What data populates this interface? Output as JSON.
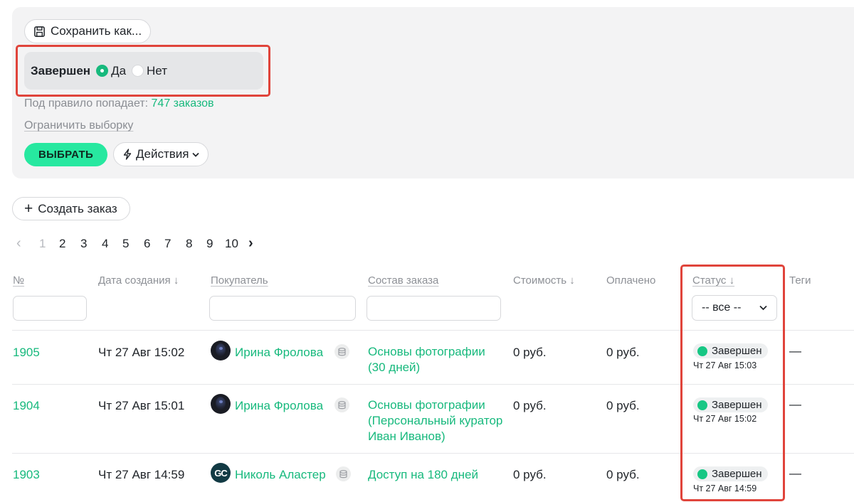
{
  "toolbar": {
    "save_label": "Сохранить как..."
  },
  "rule": {
    "label": "Завершен",
    "options": [
      {
        "label": "Да",
        "selected": true
      },
      {
        "label": "Нет",
        "selected": false
      }
    ]
  },
  "summary": {
    "prefix": "Под правило попадает: ",
    "count": "747 заказов"
  },
  "limit_link": "Ограничить выборку",
  "select_button": "ВЫБРАТЬ",
  "actions_button": "Действия",
  "create_button": "Создать заказ",
  "pagination": {
    "prev": "‹",
    "next": "›",
    "pages": [
      "1",
      "2",
      "3",
      "4",
      "5",
      "6",
      "7",
      "8",
      "9",
      "10"
    ],
    "current": "1"
  },
  "columns": [
    "№",
    "Дата создания ↓",
    "Покупатель",
    "Состав заказа",
    "Стоимость ↓",
    "Оплачено",
    "Статус ↓",
    "Теги"
  ],
  "status_filter": {
    "value": "-- все --"
  },
  "orders": [
    {
      "id": "1905",
      "date": "Чт 27 Авг 15:02",
      "buyer": "Ирина Фролова",
      "avatar": "photo",
      "items": "Основы фотографии (30 дней)",
      "cost": "0 руб.",
      "paid": "0 руб.",
      "status": "Завершен",
      "status_date": "Чт 27 Авг 15:03",
      "tags": "—"
    },
    {
      "id": "1904",
      "date": "Чт 27 Авг 15:01",
      "buyer": "Ирина Фролова",
      "avatar": "photo",
      "items": "Основы фотографии (Персональный куратор Иван Иванов)",
      "cost": "0 руб.",
      "paid": "0 руб.",
      "status": "Завершен",
      "status_date": "Чт 27 Авг 15:02",
      "tags": "—"
    },
    {
      "id": "1903",
      "date": "Чт 27 Авг 14:59",
      "buyer": "Николь Аластер",
      "avatar": "GC",
      "items": "Доступ на 180 дней",
      "cost": "0 руб.",
      "paid": "0 руб.",
      "status": "Завершен",
      "status_date": "Чт 27 Авг 14:59",
      "tags": "—"
    }
  ],
  "colors": {
    "accent": "#17b97d",
    "button": "#27e8a0",
    "highlight": "#e0443b",
    "panel": "#f3f3f4"
  }
}
